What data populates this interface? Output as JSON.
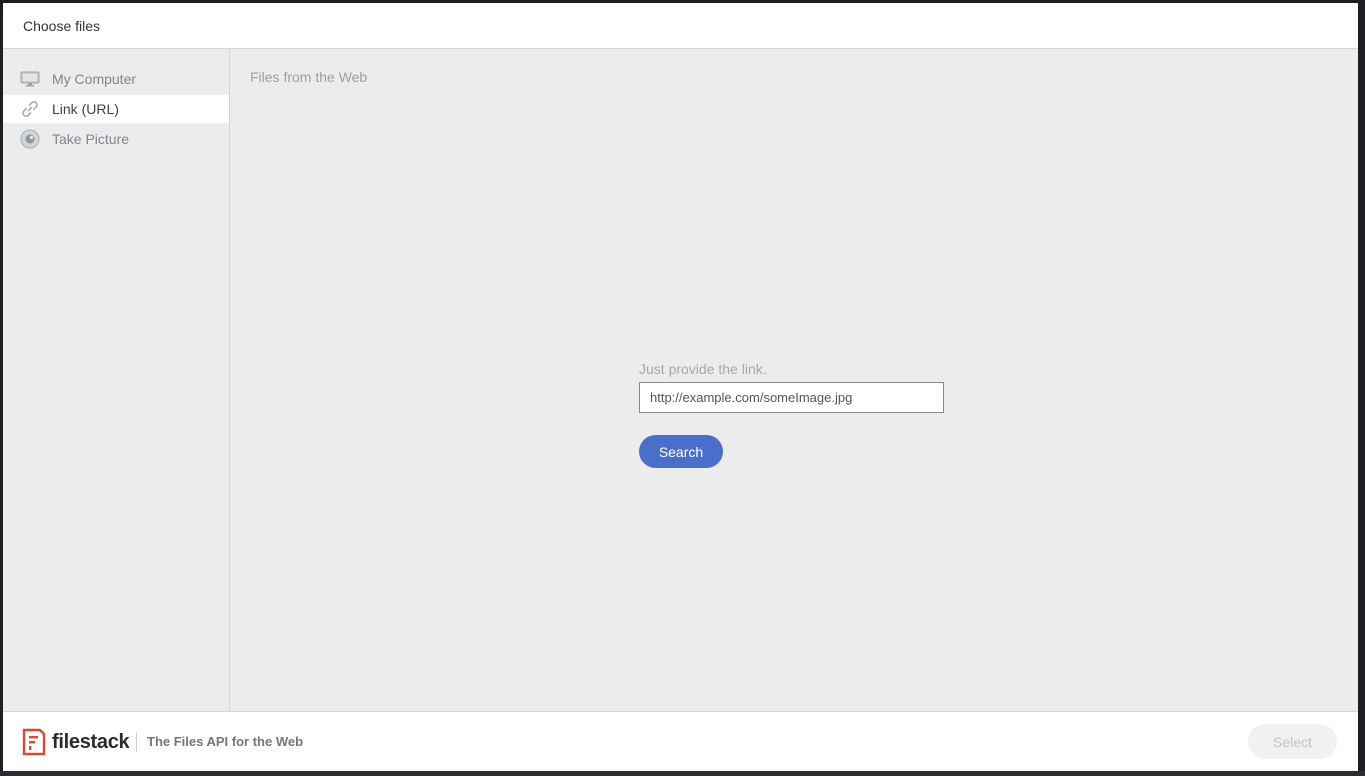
{
  "header": {
    "title": "Choose files"
  },
  "sidebar": {
    "items": [
      {
        "label": "My Computer",
        "icon": "monitor-icon",
        "active": false
      },
      {
        "label": "Link (URL)",
        "icon": "link-icon",
        "active": true
      },
      {
        "label": "Take Picture",
        "icon": "camera-icon",
        "active": false
      }
    ]
  },
  "main": {
    "title": "Files from the Web",
    "link_label": "Just provide the link.",
    "link_placeholder": "http://example.com/someImage.jpg",
    "link_value": "",
    "search_label": "Search"
  },
  "footer": {
    "brand": "filestack",
    "tagline": "The Files API for the Web",
    "select_label": "Select"
  },
  "colors": {
    "accent": "#4a6fcb",
    "brand": "#e0482e",
    "panel": "#ececec"
  }
}
